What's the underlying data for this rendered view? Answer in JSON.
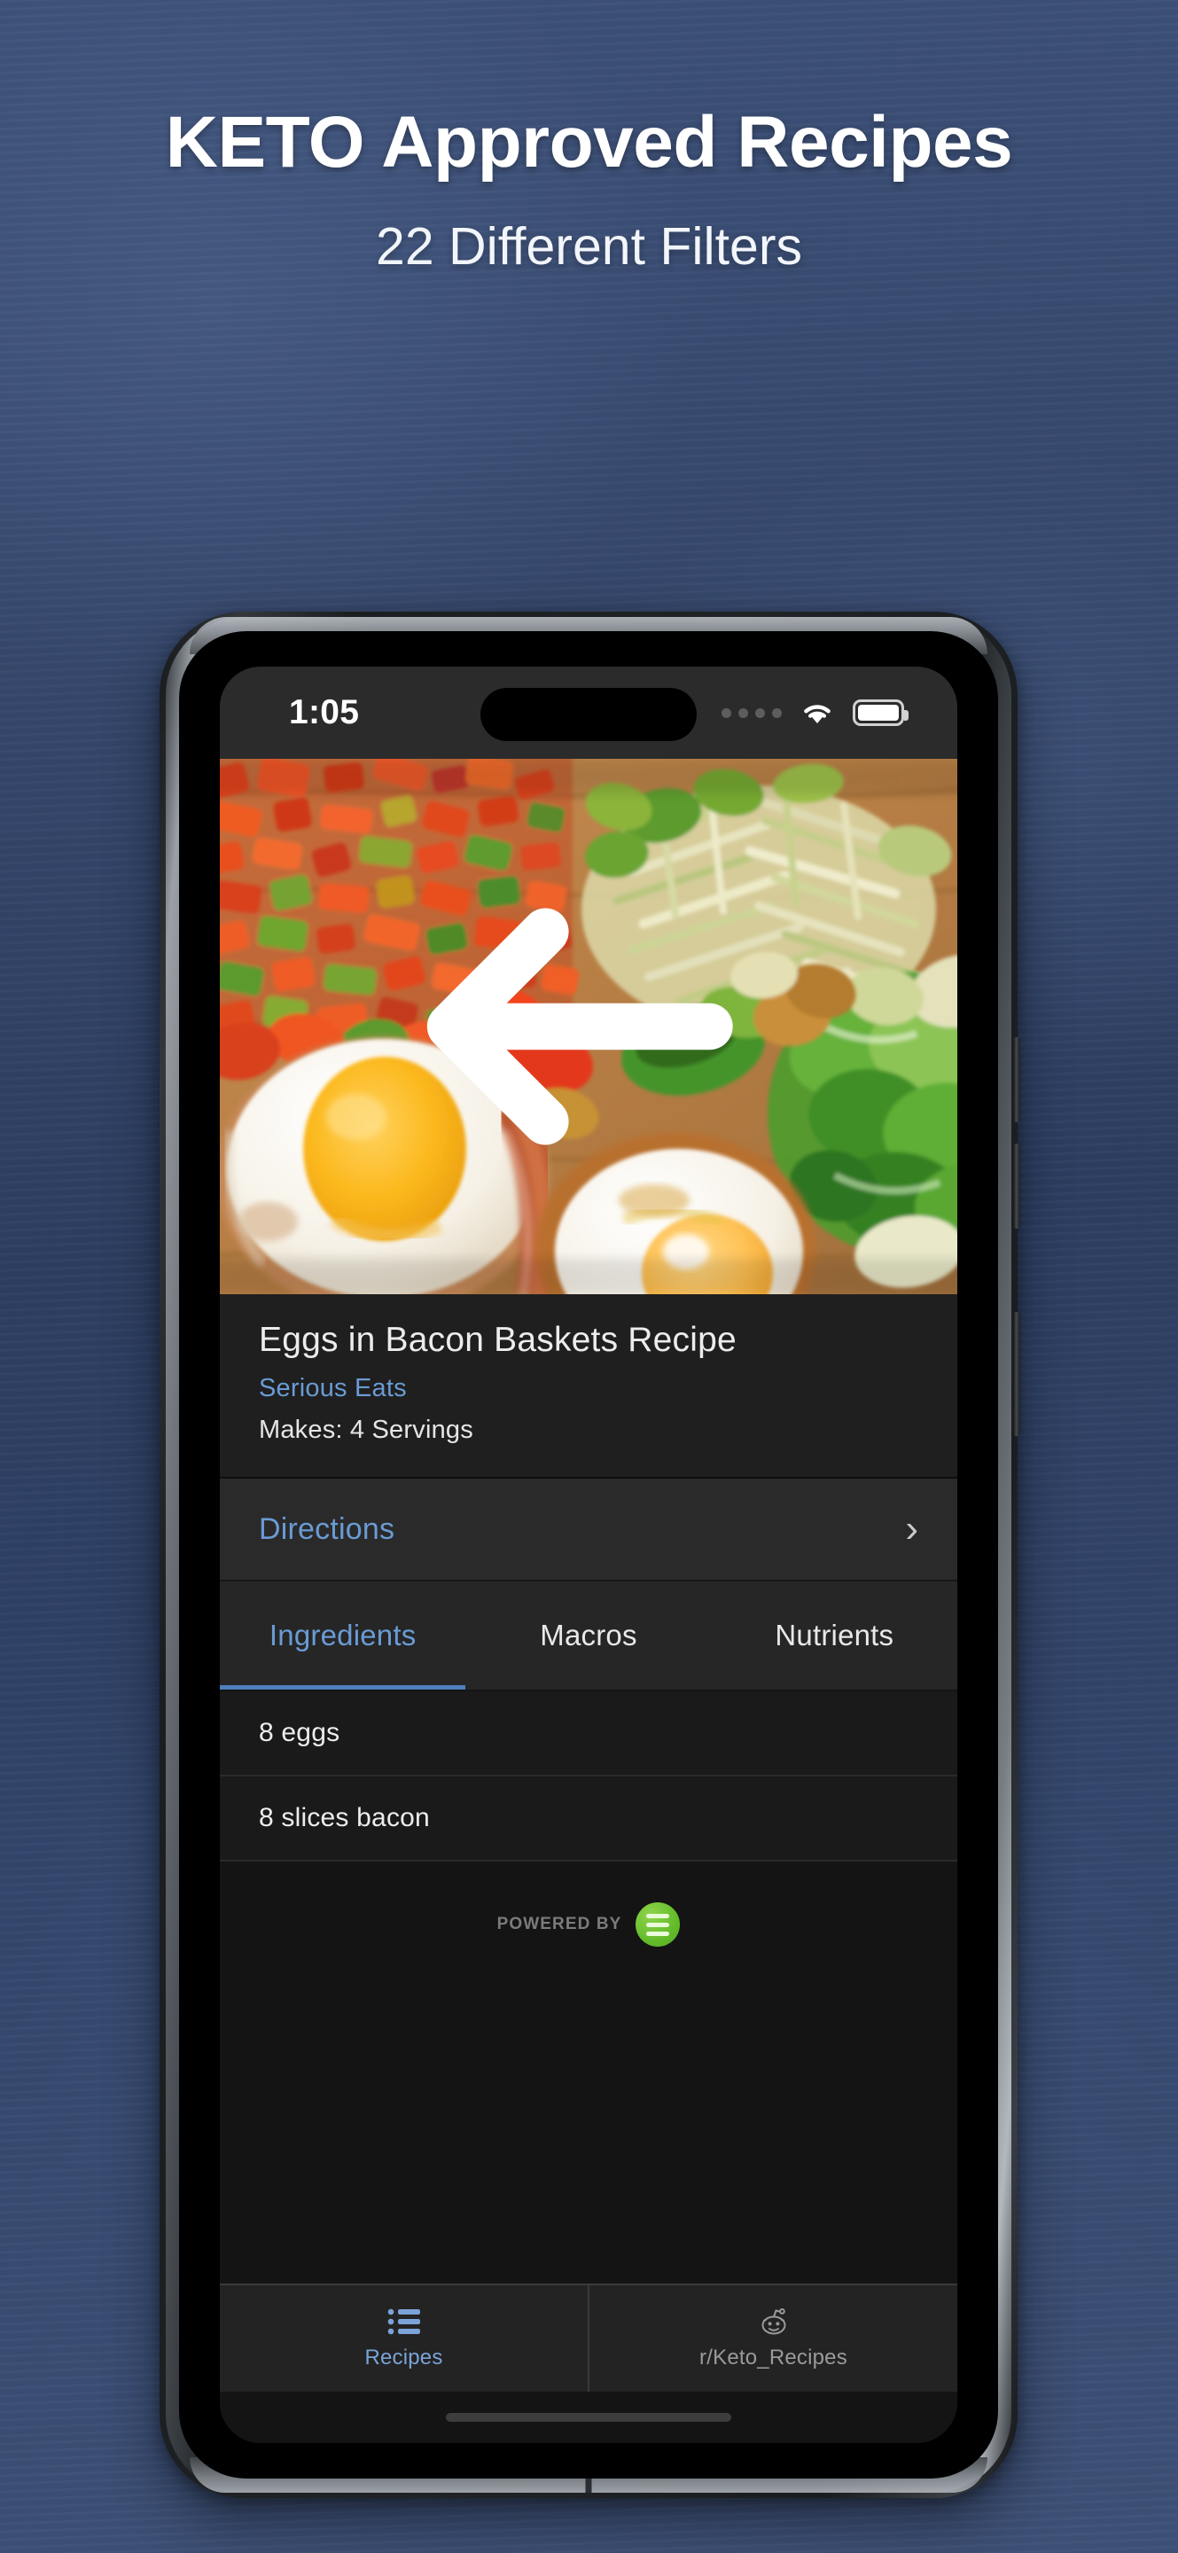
{
  "promo": {
    "headline": "KETO Approved Recipes",
    "subheadline": "22 Different Filters"
  },
  "colors": {
    "accent_blue": "#6a9bd4",
    "nav_active": "#7ba3d8",
    "tab_underline": "#4d7ebd",
    "logo_green": "#63bb2a",
    "screen_bg": "#141414",
    "background_blue": "#35486c"
  },
  "status_bar": {
    "time": "1:05",
    "signal_icon": "cell-signal-dots-icon",
    "wifi_icon": "wifi-icon",
    "battery_icon": "battery-full-icon",
    "notch": "dynamic-island"
  },
  "hero": {
    "back_icon": "back-arrow-icon",
    "image_alt": "Eggs in bacon baskets with peppers, leeks and lettuce on a wooden board"
  },
  "recipe": {
    "title": "Eggs in Bacon Baskets Recipe",
    "source": "Serious Eats",
    "servings": "Makes: 4 Servings"
  },
  "directions": {
    "label": "Directions",
    "chevron": "›",
    "chevron_icon": "chevron-right-icon"
  },
  "tabs": [
    {
      "label": "Ingredients",
      "active": true
    },
    {
      "label": "Macros",
      "active": false
    },
    {
      "label": "Nutrients",
      "active": false
    }
  ],
  "ingredients": [
    {
      "text": "8 eggs"
    },
    {
      "text": "8 slices bacon"
    }
  ],
  "powered_by": {
    "label": "POWERED BY",
    "logo_icon": "nutritionix-logo-icon"
  },
  "bottom_nav": [
    {
      "label": "Recipes",
      "icon": "list-icon",
      "active": true
    },
    {
      "label": "r/Keto_Recipes",
      "icon": "reddit-alien-icon",
      "active": false
    }
  ]
}
